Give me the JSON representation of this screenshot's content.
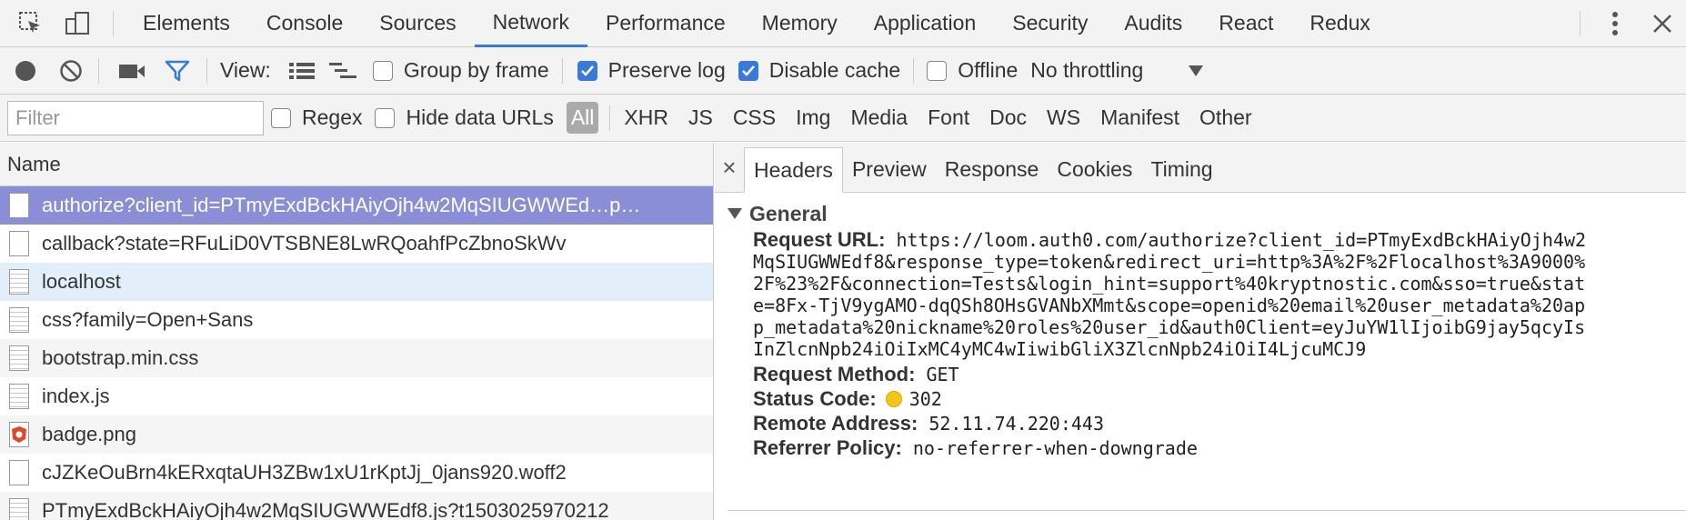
{
  "tabs": [
    "Elements",
    "Console",
    "Sources",
    "Network",
    "Performance",
    "Memory",
    "Application",
    "Security",
    "Audits",
    "React",
    "Redux"
  ],
  "active_tab": "Network",
  "toolbar": {
    "view_label": "View:",
    "group_by_frame": "Group by frame",
    "preserve_log": "Preserve log",
    "disable_cache": "Disable cache",
    "offline": "Offline",
    "throttling": "No throttling"
  },
  "filterbar": {
    "placeholder": "Filter",
    "regex": "Regex",
    "hide_data_urls": "Hide data URLs",
    "types": [
      "All",
      "XHR",
      "JS",
      "CSS",
      "Img",
      "Media",
      "Font",
      "Doc",
      "WS",
      "Manifest",
      "Other"
    ]
  },
  "left": {
    "header": "Name",
    "rows": [
      "authorize?client_id=PTmyExdBckHAiyOjh4w2MqSIUGWWEd…p…",
      "callback?state=RFuLiD0VTSBNE8LwRQoahfPcZbnoSkWv",
      "localhost",
      "css?family=Open+Sans",
      "bootstrap.min.css",
      "index.js",
      "badge.png",
      "cJZKeOuBrn4kERxqtaUH3ZBw1xU1rKptJj_0jans920.woff2",
      "PTmyExdBckHAiyOjh4w2MqSIUGWWEdf8.js?t1503025970212"
    ]
  },
  "right": {
    "tabs": [
      "Headers",
      "Preview",
      "Response",
      "Cookies",
      "Timing"
    ],
    "section_title": "General",
    "request_url_label": "Request URL:",
    "request_url_lines": [
      "https://loom.auth0.com/authorize?client_id=PTmyExdBckHAiyOjh4w2",
      "MqSIUGWWEdf8&response_type=token&redirect_uri=http%3A%2F%2Flocalhost%3A9000%",
      "2F%23%2F&connection=Tests&login_hint=support%40kryptnostic.com&sso=true&stat",
      "e=8Fx-TjV9ygAMO-dqQSh8OHsGVANbXMmt&scope=openid%20email%20user_metadata%20ap",
      "p_metadata%20nickname%20roles%20user_id&auth0Client=eyJuYW1lIjoibG9jay5qcyIs",
      "InZlcnNpb24iOiIxMC4yMC4wIiwibGliX3ZlcnNpb24iOiI4LjcuMCJ9"
    ],
    "request_method_label": "Request Method:",
    "request_method": "GET",
    "status_code_label": "Status Code:",
    "status_code": "302",
    "remote_address_label": "Remote Address:",
    "remote_address": "52.11.74.220:443",
    "referrer_policy_label": "Referrer Policy:",
    "referrer_policy": "no-referrer-when-downgrade"
  }
}
